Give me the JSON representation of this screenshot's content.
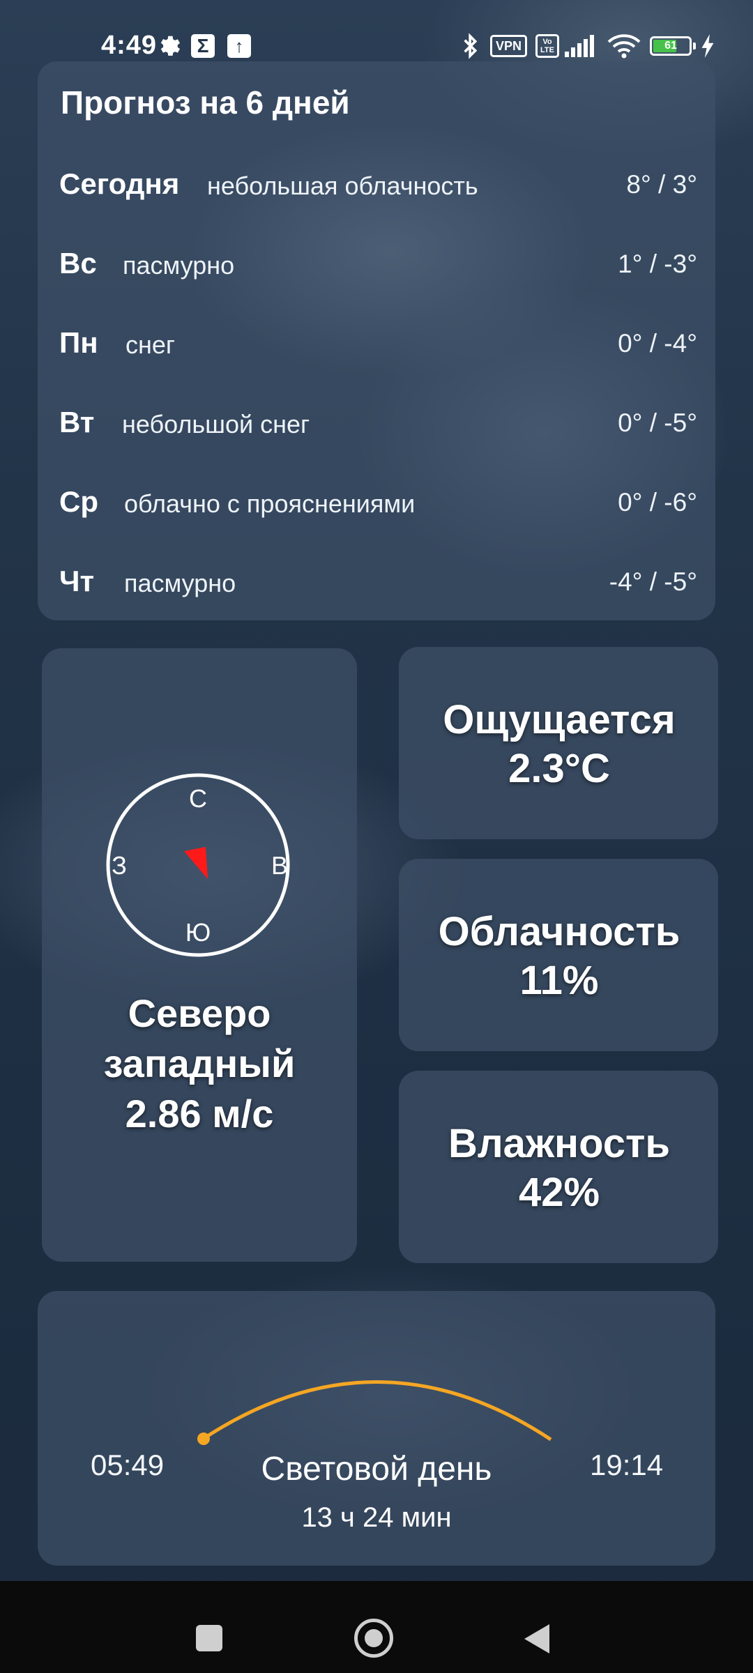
{
  "status_bar": {
    "time": "4:49",
    "vpn": "VPN",
    "volte_top": "Vo",
    "volte_bottom": "LTE",
    "battery": "61"
  },
  "forecast": {
    "title": "Прогноз на 6 дней",
    "rows": [
      {
        "day": "Сегодня",
        "desc": "небольшая облачность",
        "temp": "8° / 3°"
      },
      {
        "day": "Вс",
        "desc": "пасмурно",
        "temp": "1° / -3°"
      },
      {
        "day": "Пн",
        "desc": "снег",
        "temp": "0° / -4°"
      },
      {
        "day": "Вт",
        "desc": "небольшой снег",
        "temp": "0° / -5°"
      },
      {
        "day": "Ср",
        "desc": "облачно с прояснениями",
        "temp": "0° / -6°"
      },
      {
        "day": "Чт",
        "desc": "пасмурно",
        "temp": "-4° / -5°"
      }
    ]
  },
  "wind": {
    "compass": {
      "n": "С",
      "s": "Ю",
      "e": "В",
      "w": "З"
    },
    "direction_line1": "Северо",
    "direction_line2": "западный",
    "speed": "2.86 м/с",
    "arrow_color": "#ff1a1a"
  },
  "feels_like": {
    "label": "Ощущается",
    "value": "2.3°C"
  },
  "cloudiness": {
    "label": "Облачность",
    "value": "11%"
  },
  "humidity": {
    "label": "Влажность",
    "value": "42%"
  },
  "daylight": {
    "sunrise": "05:49",
    "sunset": "19:14",
    "label": "Световой день",
    "duration": "13 ч 24 мин",
    "arc_color": "#f5a623"
  },
  "nav": {
    "icons": [
      "recents-icon",
      "home-icon",
      "back-icon"
    ]
  }
}
